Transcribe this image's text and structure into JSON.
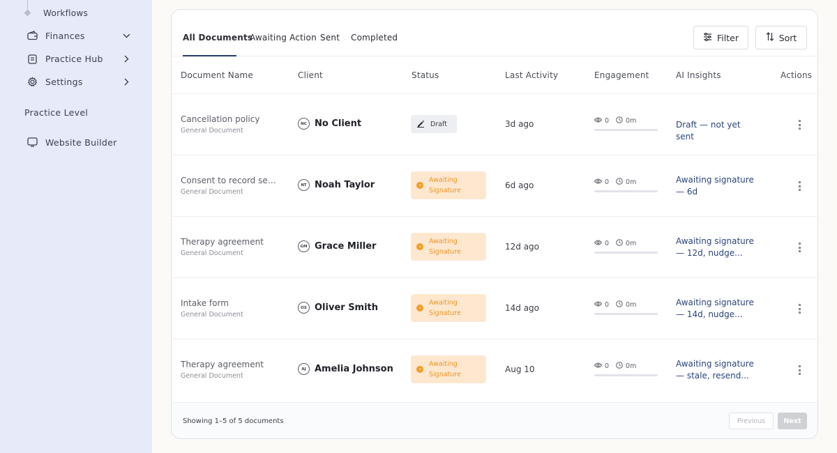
{
  "sidebar": {
    "workflows": "Workflows",
    "items": [
      {
        "label": "Finances",
        "icon": "wallet-icon",
        "chevron": "chevron-down-icon"
      },
      {
        "label": "Practice Hub",
        "icon": "clipboard-icon",
        "chevron": "chevron-right-icon"
      },
      {
        "label": "Settings",
        "icon": "gear-icon",
        "chevron": "chevron-right-icon"
      }
    ],
    "section_label": "Practice Level",
    "website_builder": "Website Builder"
  },
  "tabs": [
    "All Documents",
    "Awaiting Action",
    "Sent",
    "Completed"
  ],
  "active_tab": "All Documents",
  "toolbar": {
    "filter_label": "Filter",
    "sort_label": "Sort"
  },
  "columns": [
    "Document Name",
    "Client",
    "Status",
    "Last Activity",
    "Engagement",
    "AI Insights",
    "Actions"
  ],
  "rows": [
    {
      "name": "Cancellation policy",
      "type": "General Document",
      "initials": "NC",
      "client": "No Client",
      "status": "Draft",
      "last_activity": "3d ago",
      "views": "0",
      "time": "0m",
      "insight": "Draft — not yet sent"
    },
    {
      "name": "Consent to record sessi...",
      "type": "General Document",
      "initials": "NT",
      "client": "Noah Taylor",
      "status": "Awaiting Signature",
      "last_activity": "6d ago",
      "views": "0",
      "time": "0m",
      "insight": "Awaiting signature — 6d"
    },
    {
      "name": "Therapy agreement",
      "type": "General Document",
      "initials": "GM",
      "client": "Grace Miller",
      "status": "Awaiting Signature",
      "last_activity": "12d ago",
      "views": "0",
      "time": "0m",
      "insight": "Awaiting signature — 12d, nudge..."
    },
    {
      "name": "Intake form",
      "type": "General Document",
      "initials": "OS",
      "client": "Oliver Smith",
      "status": "Awaiting Signature",
      "last_activity": "14d ago",
      "views": "0",
      "time": "0m",
      "insight": "Awaiting signature — 14d, nudge..."
    },
    {
      "name": "Therapy agreement",
      "type": "General Document",
      "initials": "AJ",
      "client": "Amelia Johnson",
      "status": "Awaiting Signature",
      "last_activity": "Aug 10",
      "views": "0",
      "time": "0m",
      "insight": "Awaiting signature — stale, resend..."
    }
  ],
  "footer": {
    "showing": "Showing 1–5 of 5 documents",
    "previous": "Previous",
    "next": "Next"
  },
  "colors": {
    "sidebar_bg": "#e7eaf8",
    "accent": "#243a6b",
    "await_bg": "#fde8cf",
    "await_text": "#e9962a",
    "insight_text": "#2b4479"
  }
}
